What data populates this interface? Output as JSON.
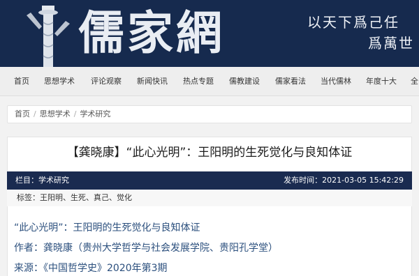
{
  "header": {
    "site_name": "儒家網",
    "slogan_line1": "以天下爲己任",
    "slogan_line2": "爲萬世"
  },
  "nav": {
    "items": [
      "首页",
      "思想学术",
      "评论观察",
      "新闻快讯",
      "热点专题",
      "儒教建设",
      "儒家看法",
      "当代儒林",
      "年度十大",
      "全"
    ]
  },
  "breadcrumb": {
    "items": [
      "首页",
      "思想学术",
      "学术研究"
    ],
    "separator": "/"
  },
  "article": {
    "title": "【龚晓康】“此心光明”：王阳明的生死觉化与良知体证",
    "column": "栏目：学术研究",
    "publish_time": "发布时间：2021-03-05 15:42:29",
    "tags_prefix": "标签：",
    "tags": [
      "王阳明",
      "生死",
      "真己",
      "觉化"
    ],
    "tag_separator": "、",
    "body_lines": [
      "“此心光明”：王阳明的生死觉化与良知体证",
      "作者：龚晓康（贵州大学哲学与社会发展学院、贵阳孔学堂）",
      "来源：《中国哲学史》2020年第3期"
    ]
  },
  "colors": {
    "banner": "#162a4e",
    "meta_bar": "#1a2b50",
    "link_text": "#2b4f7d"
  },
  "icons": [
    "huabiao-pillar-logo"
  ]
}
